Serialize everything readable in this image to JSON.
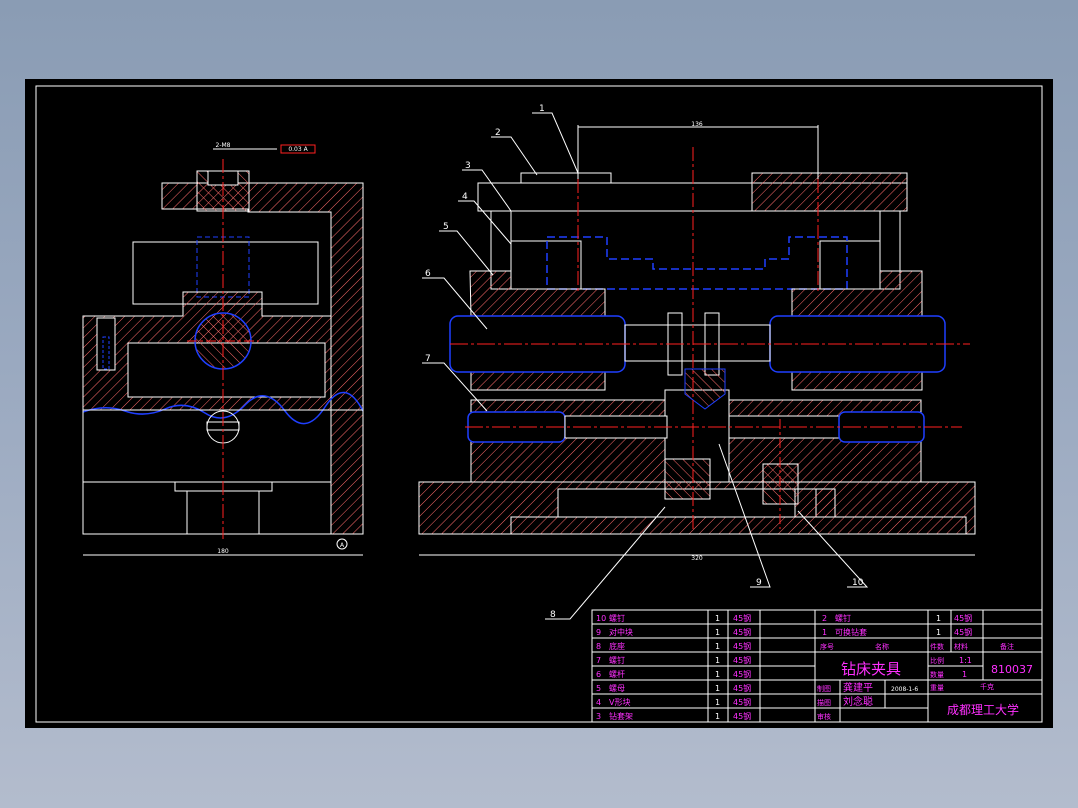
{
  "drawing": {
    "side_view": {
      "dim_width": "180",
      "dim_top": "2-M8",
      "tolerance": "0.03 A",
      "datum": "A"
    },
    "front_view": {
      "dim_top": "136",
      "dim_width": "320"
    },
    "balloons": [
      "1",
      "2",
      "3",
      "4",
      "5",
      "6",
      "7",
      "8",
      "9",
      "10"
    ]
  },
  "bom_rows_left": [
    {
      "no": "10",
      "name": "螺钉",
      "qty": "1",
      "material": "45钢"
    },
    {
      "no": "9",
      "name": "对中块",
      "qty": "1",
      "material": "45钢"
    },
    {
      "no": "8",
      "name": "底座",
      "qty": "1",
      "material": "45钢"
    },
    {
      "no": "7",
      "name": "螺钉",
      "qty": "1",
      "material": "45钢"
    },
    {
      "no": "6",
      "name": "螺杆",
      "qty": "1",
      "material": "45钢"
    },
    {
      "no": "5",
      "name": "螺母",
      "qty": "1",
      "material": "45钢"
    },
    {
      "no": "4",
      "name": "V形块",
      "qty": "1",
      "material": "45钢"
    },
    {
      "no": "3",
      "name": "钻套架",
      "qty": "1",
      "material": "45钢"
    }
  ],
  "bom_rows_right": [
    {
      "no": "2",
      "name": "螺钉",
      "qty": "1",
      "material": "45钢"
    },
    {
      "no": "1",
      "name": "可换钻套",
      "qty": "1",
      "material": "45钢"
    }
  ],
  "bom_header": {
    "seq": "序号",
    "name": "名称",
    "count": "件数",
    "material": "材料",
    "remark": "备注"
  },
  "title_block": {
    "title": "钻床夹具",
    "drawing_no": "810037",
    "scale_label": "比例",
    "scale": "1:1",
    "qty_label": "数量",
    "qty": "1",
    "weight_label": "重量",
    "weight_unit": "千克",
    "draw_label": "制图",
    "draw_name": "龚建平",
    "draw_date": "2008-1-6",
    "design_label": "描图",
    "design_name": "刘念聪",
    "check_label": "审核",
    "school": "成都理工大学"
  },
  "colors": {
    "outline": "#ffffff",
    "hatch": "#ff6b6b",
    "center": "#ff2020",
    "hidden": "#1f3fff",
    "text": "#ff30ff",
    "dim": "#ffffff",
    "table": "#ffffff",
    "background": "#000000"
  }
}
